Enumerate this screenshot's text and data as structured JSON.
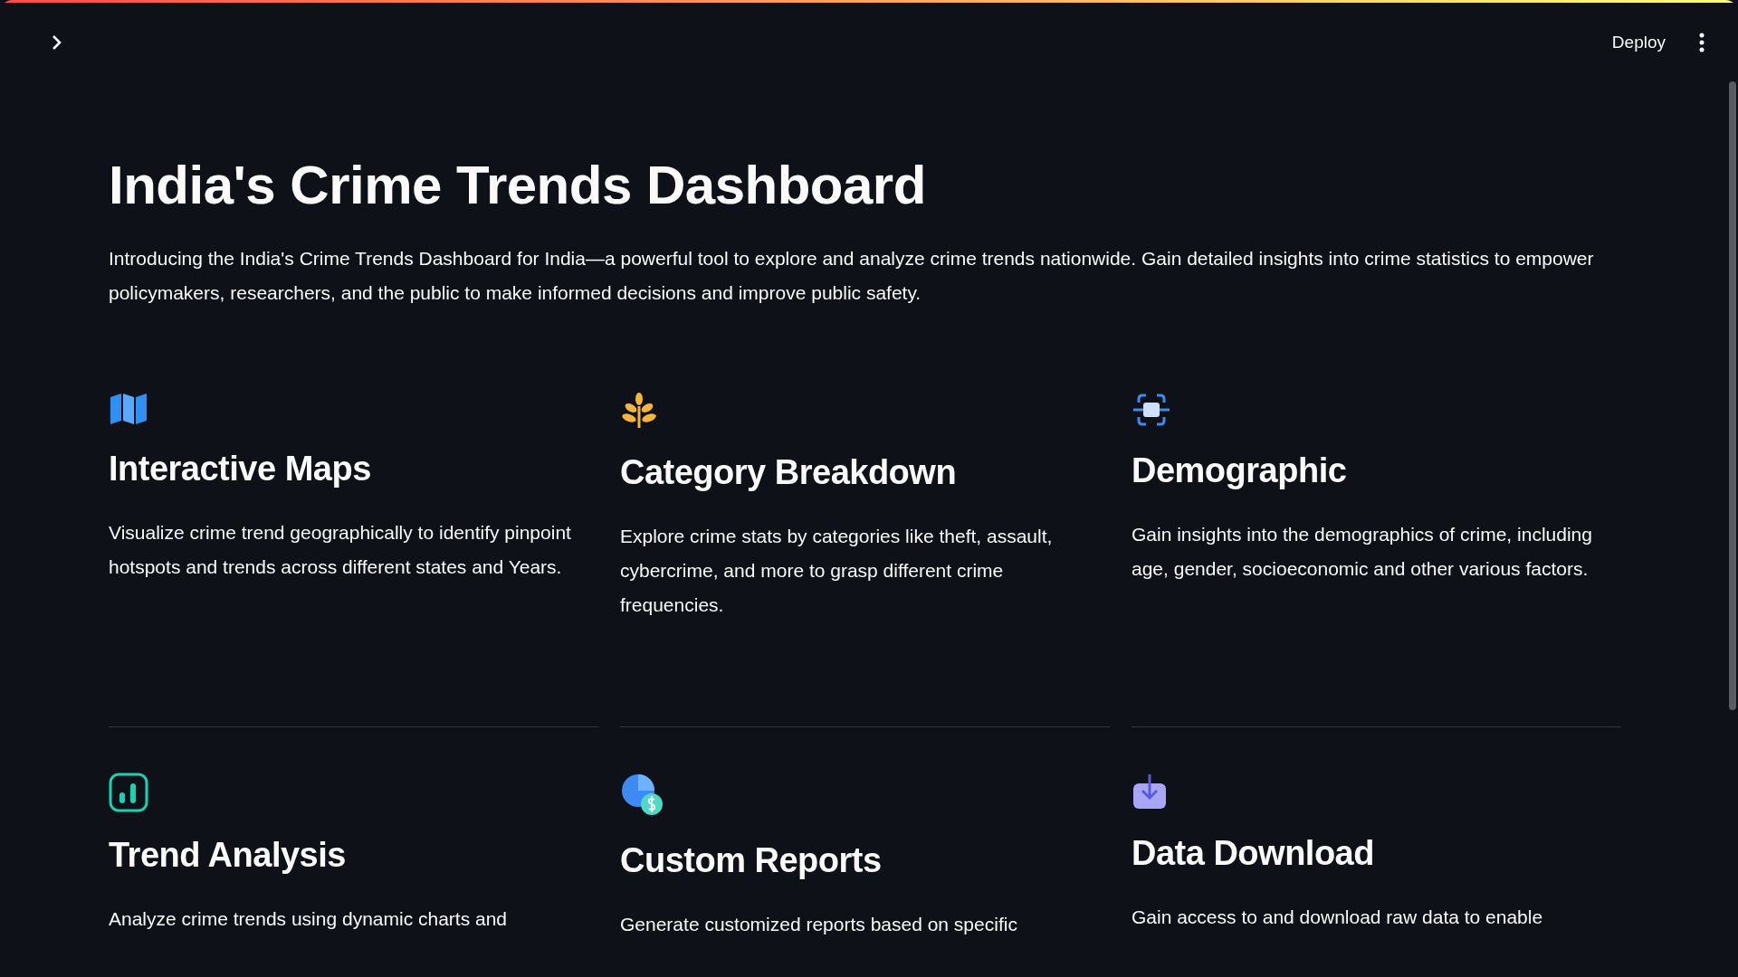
{
  "header": {
    "deploy": "Deploy"
  },
  "title": "India's Crime Trends Dashboard",
  "intro": "Introducing the India's Crime Trends Dashboard for India—a powerful tool to explore and analyze crime trends nationwide. Gain detailed insights into crime statistics to empower policymakers, researchers, and the public to make informed decisions and improve public safety.",
  "features": [
    {
      "kind": "map",
      "title": "Interactive Maps",
      "text": "Visualize crime trend geographically to identify pinpoint hotspots and trends across different states and Years."
    },
    {
      "kind": "sprout",
      "title": "Category Breakdown",
      "text": "Explore crime stats by categories like theft, assault, cybercrime, and more to grasp different crime frequencies."
    },
    {
      "kind": "scan",
      "title": "Demographic",
      "text": "Gain insights into the demographics of crime, including age, gender, socioeconomic and other various factors."
    },
    {
      "kind": "chart",
      "title": "Trend Analysis",
      "text": "Analyze crime trends using dynamic charts and"
    },
    {
      "kind": "pie",
      "title": "Custom Reports",
      "text": "Generate customized reports based on specific"
    },
    {
      "kind": "download",
      "title": "Data Download",
      "text": "Gain access to and download raw data to enable"
    }
  ]
}
